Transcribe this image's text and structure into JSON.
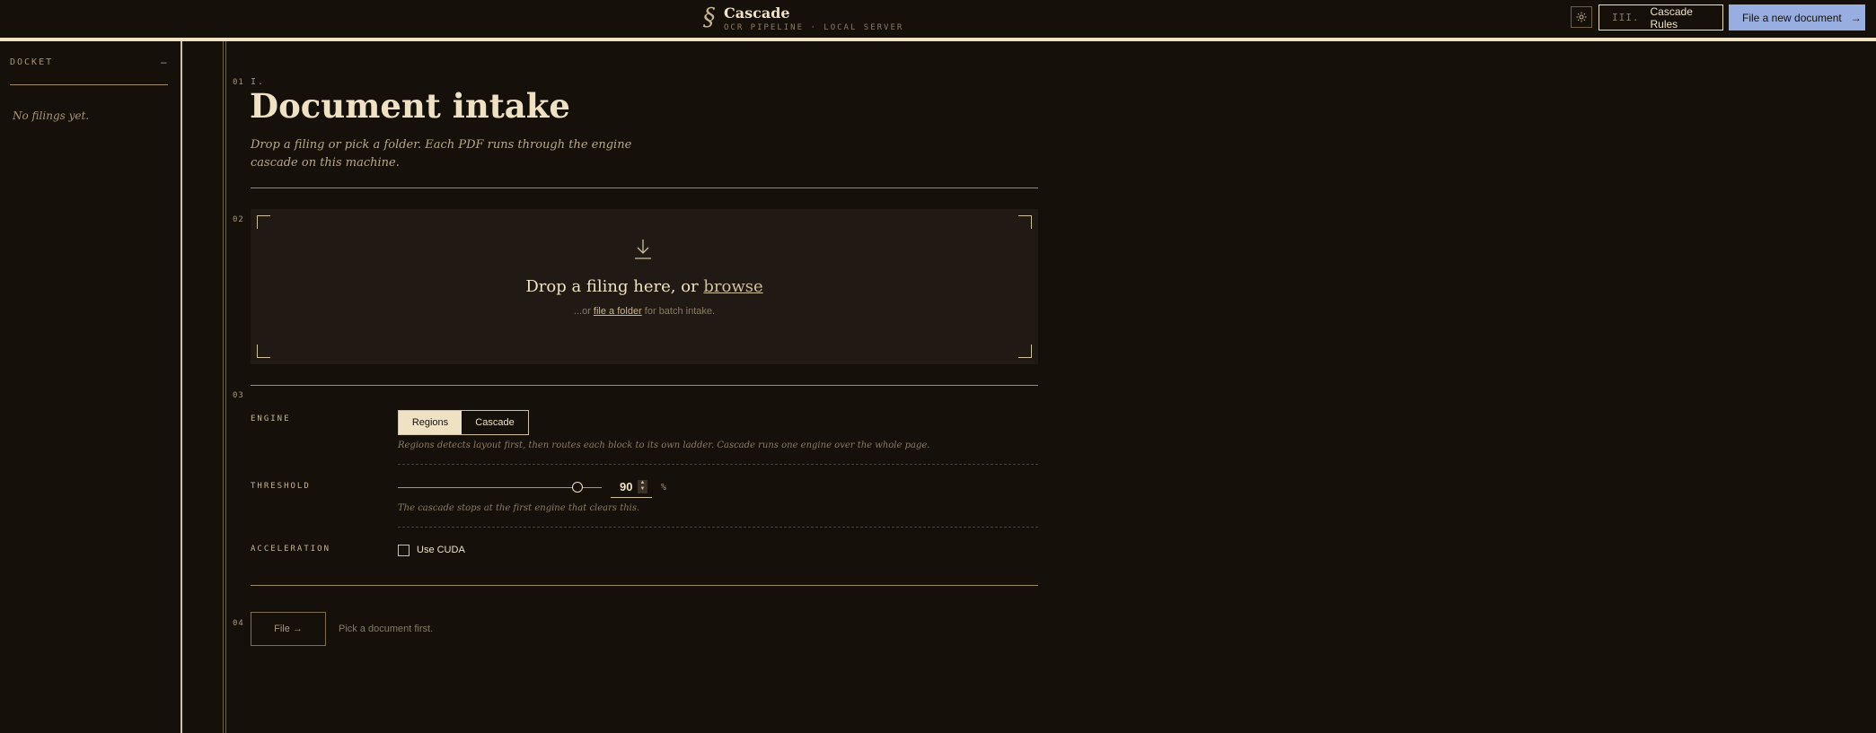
{
  "app": {
    "brand_mark": "§",
    "title": "Cascade",
    "subtitle": "OCR PIPELINE · LOCAL SERVER",
    "theme_icon": "sun-icon",
    "rules_num": "III.",
    "rules_label": "Cascade Rules",
    "new_label": "File a new document",
    "new_arrow": "→"
  },
  "sidebar": {
    "title": "DOCKET",
    "collapse": "–",
    "empty": "No filings yet."
  },
  "sections": {
    "n1": "01",
    "n2": "02",
    "n3": "03",
    "n4": "04"
  },
  "intake": {
    "eyebrow": "I.",
    "title": "Document intake",
    "intro": "Drop a filing or pick a folder. Each PDF runs through the engine cascade on this machine."
  },
  "dropzone": {
    "icon": "download-icon",
    "main_prefix": "Drop a filing here, or",
    "main_link": "browse",
    "sub_prefix": "...or",
    "sub_link": "file a folder",
    "sub_suffix": "for batch intake."
  },
  "engine": {
    "label": "ENGINE",
    "options": [
      "Regions",
      "Cascade"
    ],
    "selected": "Regions",
    "help": "Regions detects layout first, then routes each block to its own ladder. Cascade runs one engine over the whole page."
  },
  "threshold": {
    "label": "THRESHOLD",
    "value": "90",
    "fraction": 0.9,
    "unit": "%",
    "help": "The cascade stops at the first engine that clears this."
  },
  "acceleration": {
    "label": "ACCELERATION",
    "checkbox_label": "Use CUDA",
    "checked": false
  },
  "submit": {
    "label": "File →",
    "hint": "Pick a document first."
  },
  "colors": {
    "background": "#16100b",
    "cream": "#efe2c4",
    "accent_blue": "#98aee0",
    "muted": "#a99574"
  }
}
